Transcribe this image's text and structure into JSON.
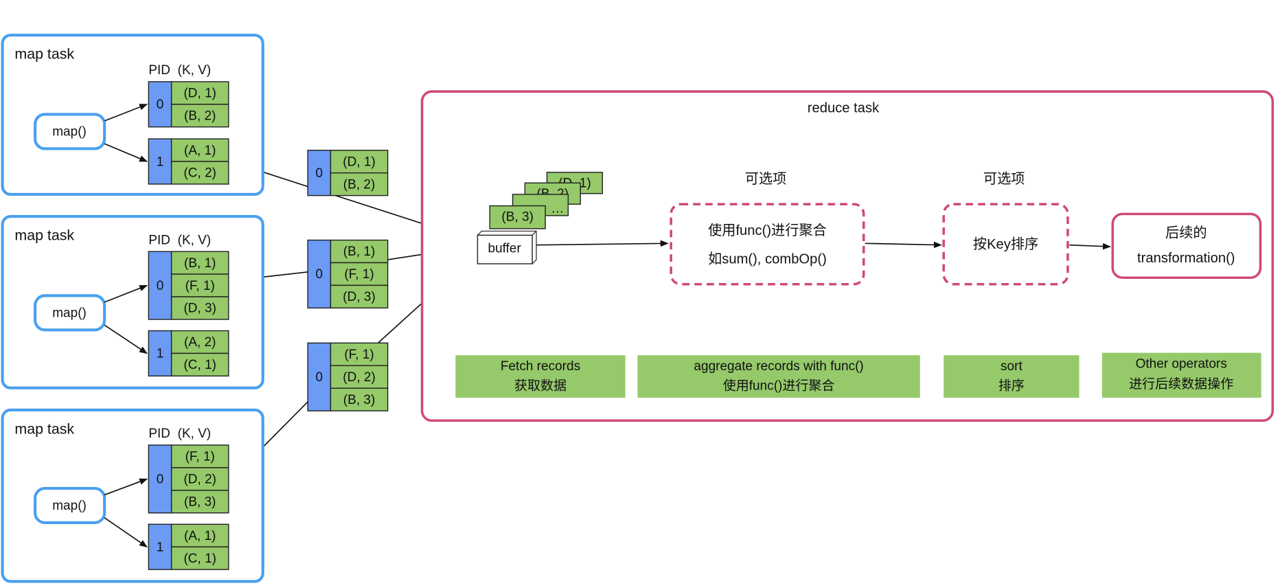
{
  "map_tasks": [
    {
      "title": "map task",
      "func": "map()",
      "header": "PID  (K, V)",
      "partitions": [
        {
          "pid": "0",
          "records": [
            "(D, 1)",
            "(B, 2)"
          ]
        },
        {
          "pid": "1",
          "records": [
            "(A, 1)",
            "(C, 2)"
          ]
        }
      ]
    },
    {
      "title": "map task",
      "func": "map()",
      "header": "PID  (K, V)",
      "partitions": [
        {
          "pid": "0",
          "records": [
            "(B, 1)",
            "(F, 1)",
            "(D, 3)"
          ]
        },
        {
          "pid": "1",
          "records": [
            "(A, 2)",
            "(C, 1)"
          ]
        }
      ]
    },
    {
      "title": "map task",
      "func": "map()",
      "header": "PID  (K, V)",
      "partitions": [
        {
          "pid": "0",
          "records": [
            "(F, 1)",
            "(D, 2)",
            "(B, 3)"
          ]
        },
        {
          "pid": "1",
          "records": [
            "(A, 1)",
            "(C, 1)"
          ]
        }
      ]
    }
  ],
  "fetched": [
    {
      "pid": "0",
      "records": [
        "(D, 1)",
        "(B, 2)"
      ]
    },
    {
      "pid": "0",
      "records": [
        "(B, 1)",
        "(F, 1)",
        "(D, 3)"
      ]
    },
    {
      "pid": "0",
      "records": [
        "(F, 1)",
        "(D, 2)",
        "(B, 3)"
      ]
    }
  ],
  "reduce": {
    "title": "reduce task",
    "buffer": "buffer",
    "stack": [
      "(D, 1)",
      "(B, 2)",
      "…",
      "(B, 3)"
    ],
    "optional_1": "可选项",
    "optional_2": "可选项",
    "agg_line1": "使用func()进行聚合",
    "agg_line2": "如sum(), combOp()",
    "sort": "按Key排序",
    "next_line1": "后续的",
    "next_line2": "transformation()",
    "phases": [
      {
        "en": "Fetch records",
        "zh": "获取数据"
      },
      {
        "en": "aggregate records with func()",
        "zh": "使用func()进行聚合"
      },
      {
        "en": "sort",
        "zh": "排序"
      },
      {
        "en": "Other operators",
        "zh": "进行后续数据操作"
      }
    ]
  }
}
